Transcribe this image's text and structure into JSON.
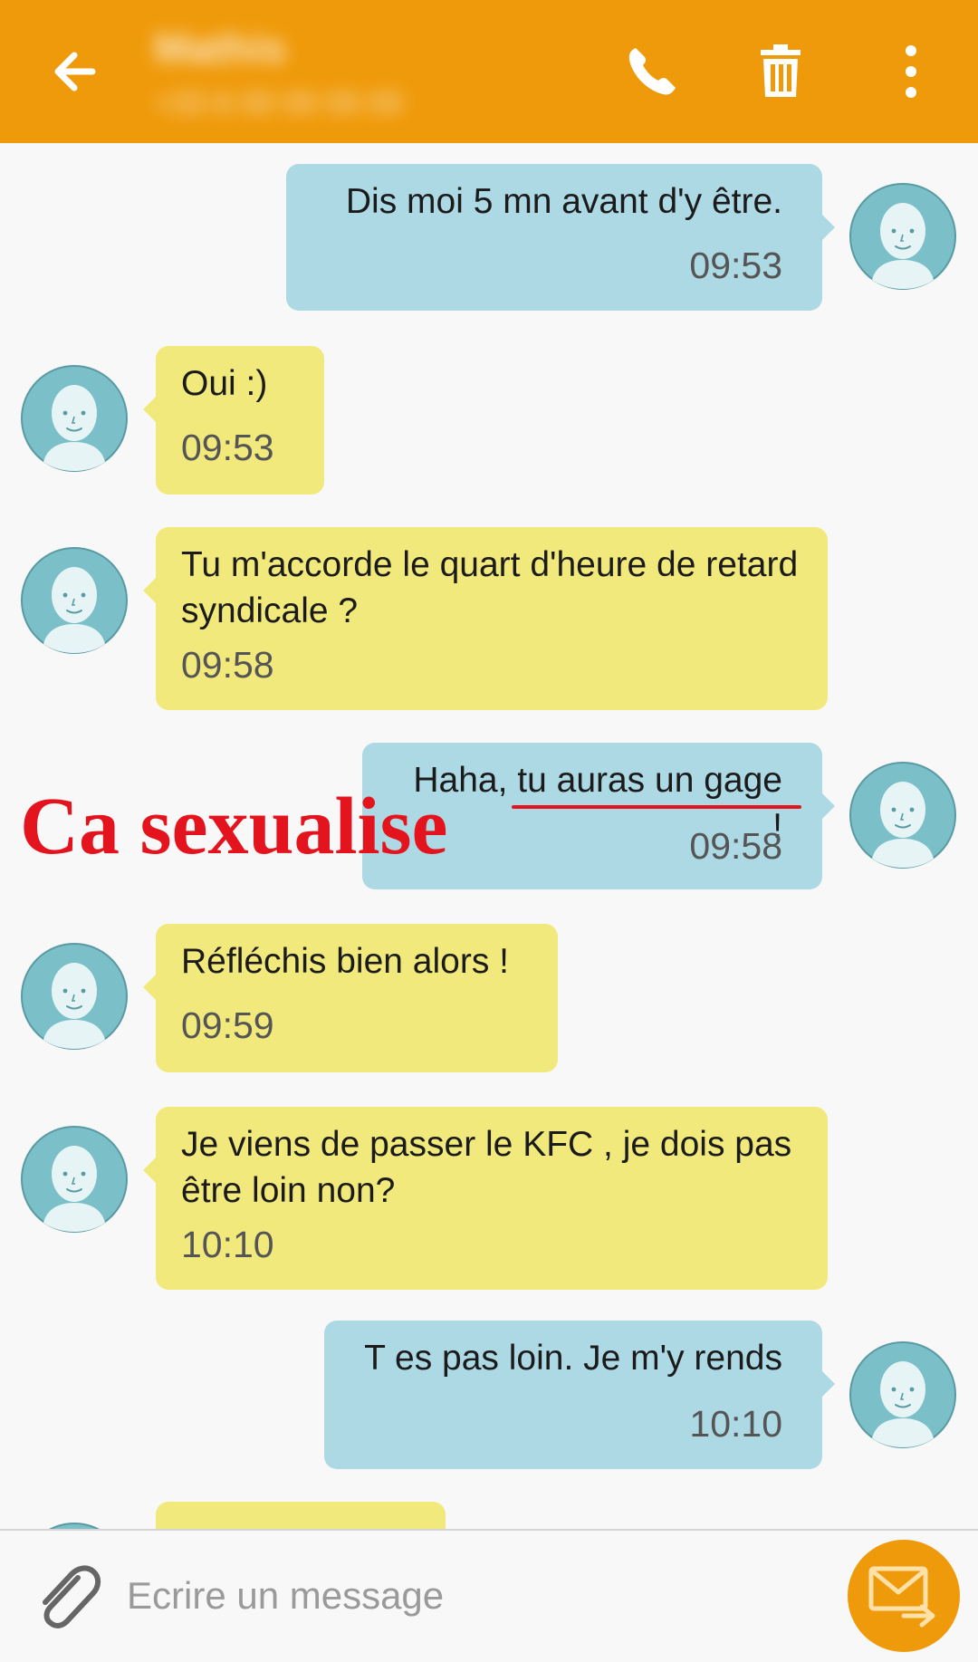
{
  "header": {
    "contact_name": "Mathis",
    "contact_number": "+33 6 00 00 00 00",
    "icons": {
      "back": "arrow-left-icon",
      "call": "phone-icon",
      "delete": "trash-icon",
      "more": "more-vertical-icon"
    },
    "color": "#ef9a0a"
  },
  "messages": [
    {
      "direction": "outgoing",
      "text": "Dis moi 5 mn avant d'y être.",
      "time": "09:53"
    },
    {
      "direction": "incoming",
      "text": "Oui :)",
      "time": "09:53"
    },
    {
      "direction": "incoming",
      "text": "Tu m'accorde le quart d'heure de retard syndicale ?",
      "time": "09:58"
    },
    {
      "direction": "outgoing",
      "text": "Haha, tu auras un gage !",
      "time": "09:58"
    },
    {
      "direction": "incoming",
      "text": "Réfléchis bien alors !",
      "time": "09:59"
    },
    {
      "direction": "incoming",
      "text": "Je viens de passer le KFC , je dois pas être loin non?",
      "time": "10:10"
    },
    {
      "direction": "outgoing",
      "text": "T es pas loin. Je m'y rends",
      "time": "10:10"
    }
  ],
  "bubble_colors": {
    "incoming": "#f2e97d",
    "outgoing": "#add9e5"
  },
  "avatar_colors": {
    "background": "#7bbfc8",
    "face": "#e6f4f6"
  },
  "annotation": {
    "text": "Ca sexualise",
    "color": "#e3141d"
  },
  "composer": {
    "placeholder": "Ecrire un message",
    "value": "",
    "icons": {
      "attach": "paperclip-icon",
      "send": "send-message-icon"
    }
  }
}
